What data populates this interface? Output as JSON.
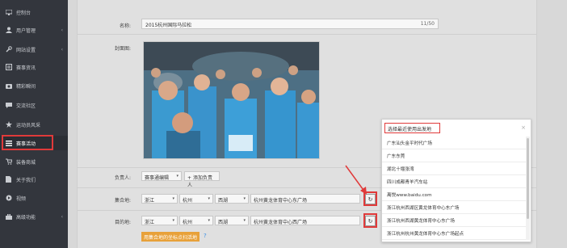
{
  "sidebar": {
    "items": [
      {
        "label": "控制台",
        "icon": "dashboard-icon",
        "chevron": ""
      },
      {
        "label": "用户管理",
        "icon": "user-icon",
        "chevron": "‹"
      },
      {
        "label": "网站设置",
        "icon": "wrench-icon",
        "chevron": "‹"
      },
      {
        "label": "赛事资讯",
        "icon": "news-icon",
        "chevron": ""
      },
      {
        "label": "精彩瞬间",
        "icon": "camera-icon",
        "chevron": ""
      },
      {
        "label": "交流社区",
        "icon": "chat-icon",
        "chevron": ""
      },
      {
        "label": "运动员风采",
        "icon": "star-icon",
        "chevron": ""
      },
      {
        "label": "赛事活动",
        "icon": "list-icon",
        "chevron": ""
      },
      {
        "label": "装备商城",
        "icon": "cart-icon",
        "chevron": ""
      },
      {
        "label": "关于我们",
        "icon": "doc-icon",
        "chevron": ""
      },
      {
        "label": "视频",
        "icon": "video-icon",
        "chevron": ""
      },
      {
        "label": "高级功能",
        "icon": "briefcase-icon",
        "chevron": "‹"
      }
    ]
  },
  "form": {
    "name_label": "名称:",
    "name_value": "2015杭州国际马拉松",
    "name_count": "11/50",
    "cover_label": "封面图:",
    "owner_label": "负责人:",
    "owner_value": "赛事通编辑",
    "add_owner": "添加负责人",
    "gather_label": "集合地:",
    "gather": {
      "province": "浙江",
      "city": "杭州",
      "district": "西湖",
      "address": "杭州黄龙体育中心东广场"
    },
    "dest_label": "目的地:",
    "dest": {
      "province": "浙江",
      "city": "杭州",
      "district": "西湖",
      "address": "杭州黄龙体育中心西广场"
    },
    "orange_button": "用集合地的坐标点扫活地",
    "undo_icon": "↻",
    "help_icon": "?"
  },
  "popup": {
    "title": "选择最近使用出发地",
    "close": "×",
    "items": [
      "广东汕头金平时代广场",
      "广东东莞",
      "湖北十堰张湾",
      "四川成都青羊汽车站",
      "离悦www.baidu.com",
      "浙江杭州西湖区黄龙体育中心东广场",
      "浙江杭州西湖黄龙体育中心东广场",
      "浙江杭州杭州黄龙体育中心东广场起点"
    ]
  },
  "colors": {
    "highlight": "#e03a3a",
    "sidebar_bg": "#33363d",
    "orange": "#e8a13a"
  }
}
